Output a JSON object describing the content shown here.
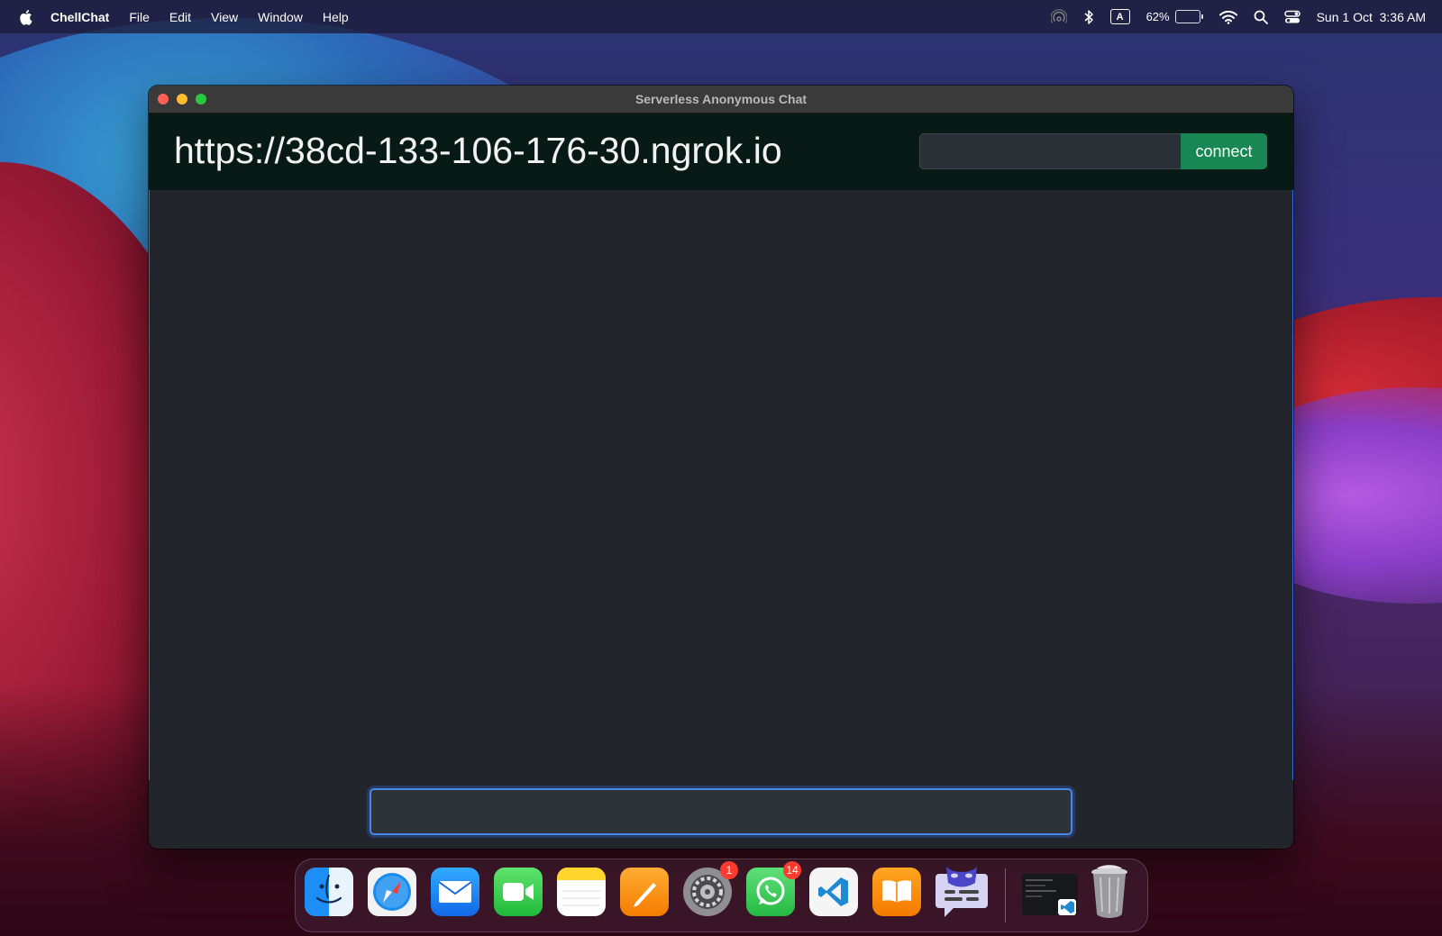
{
  "menubar": {
    "app_name": "ChellChat",
    "menus": [
      "File",
      "Edit",
      "View",
      "Window",
      "Help"
    ],
    "keyboard_input": "A",
    "battery_percent": "62%",
    "battery_level": 0.62,
    "datetime": "Sun 1 Oct  3:36 AM"
  },
  "window": {
    "title": "Serverless Anonymous Chat"
  },
  "header": {
    "url": "https://38cd-133-106-176-30.ngrok.io",
    "server_input_value": "",
    "connect_label": "connect"
  },
  "chat": {
    "message_input_value": ""
  },
  "dock": {
    "apps": [
      {
        "name": "Finder",
        "icon": "finder-icon"
      },
      {
        "name": "Safari",
        "icon": "safari-icon"
      },
      {
        "name": "Mail",
        "icon": "mail-icon"
      },
      {
        "name": "FaceTime",
        "icon": "facetime-icon"
      },
      {
        "name": "Notes",
        "icon": "notes-icon"
      },
      {
        "name": "Pages",
        "icon": "pages-icon"
      },
      {
        "name": "System Preferences",
        "icon": "gear-icon",
        "badge": "1"
      },
      {
        "name": "WhatsApp",
        "icon": "whatsapp-icon",
        "badge": "14"
      },
      {
        "name": "Visual Studio Code",
        "icon": "vscode-icon"
      },
      {
        "name": "Books",
        "icon": "books-icon"
      },
      {
        "name": "ChellChat",
        "icon": "chat-mask-icon"
      },
      {
        "name": "VS Code Window",
        "icon": "window-thumbnail-icon"
      },
      {
        "name": "Trash",
        "icon": "trash-icon"
      }
    ]
  },
  "colors": {
    "accent_blue": "#2f6fd8",
    "connect_green": "#198754",
    "header_bg": "#081a15",
    "chat_bg": "#22252b"
  }
}
